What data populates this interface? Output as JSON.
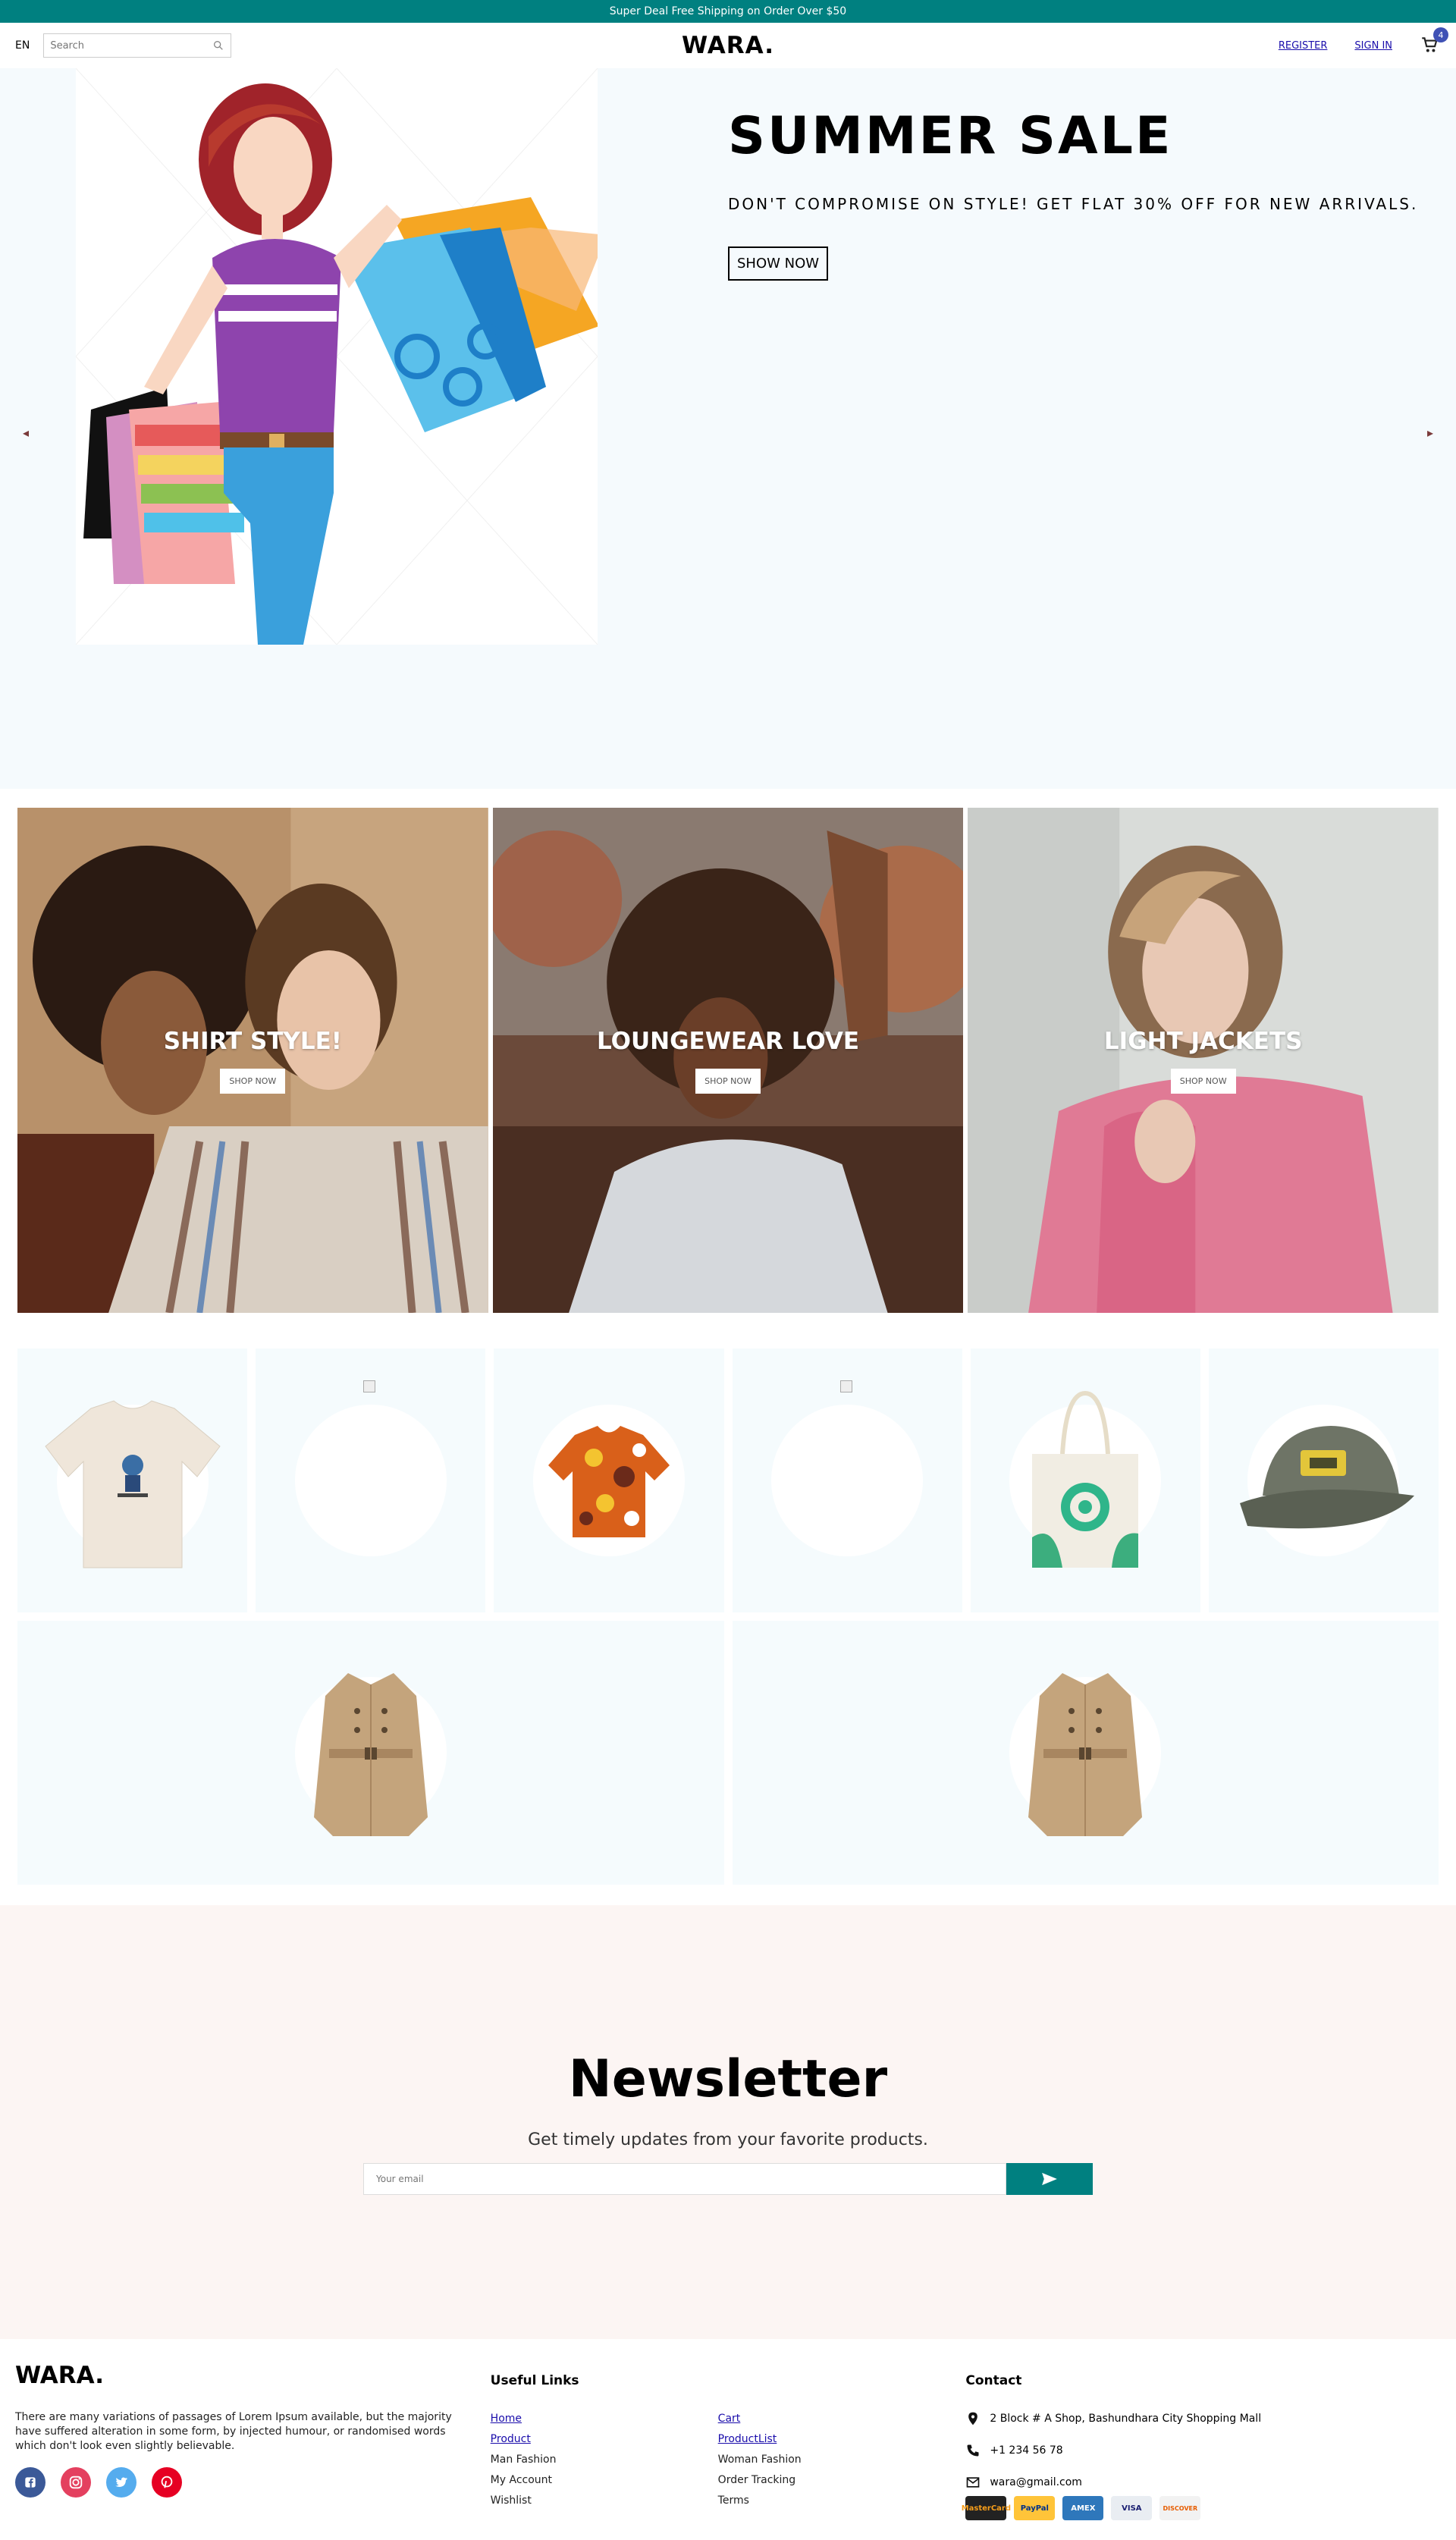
{
  "announcement": {
    "text": "Super Deal Free Shipping on Order Over $50"
  },
  "navbar": {
    "language": "EN",
    "search_placeholder": "Search",
    "logo": "WARA.",
    "register": "REGISTER",
    "signin": "SIGN IN",
    "cart_count": "4"
  },
  "hero": {
    "title": "SUMMER SALE",
    "description": "DON'T COMPROMISE ON STYLE! GET FLAT 30% OFF FOR NEW ARRIVALS.",
    "button": "SHOW NOW",
    "prev_icon": "chevron-left-icon",
    "next_icon": "chevron-right-icon"
  },
  "categories": [
    {
      "title": "SHIRT STYLE!",
      "button": "SHOP NOW"
    },
    {
      "title": "LOUNGEWEAR LOVE",
      "button": "SHOP NOW"
    },
    {
      "title": "LIGHT JACKETS",
      "button": "SHOP NOW"
    }
  ],
  "products": {
    "row1": [
      "t-shirt",
      "broken-image",
      "hawaiian-shirt",
      "broken-image",
      "tote-bag",
      "baseball-cap"
    ],
    "row2": [
      "trench-coat",
      "trench-coat"
    ]
  },
  "newsletter": {
    "title": "Newsletter",
    "description": "Get timely updates from your favorite products.",
    "placeholder": "Your email"
  },
  "footer": {
    "logo": "WARA.",
    "description": "There are many variations of passages of Lorem Ipsum available, but the majority have suffered alteration in some form, by injected humour, or randomised words which don't look even slightly believable.",
    "useful_links_title": "Useful Links",
    "links": [
      "Home",
      "Cart",
      "Product",
      "ProductList",
      "Man Fashion",
      "Woman Fashion",
      "My Account",
      "Order Tracking",
      "Wishlist",
      "Terms"
    ],
    "contact_title": "Contact",
    "address": "2 Block # A Shop, Bashundhara City Shopping Mall",
    "phone": "+1 234 56 78",
    "email": "wara@gmail.com",
    "payments": [
      "MasterCard",
      "PayPal",
      "AMEX",
      "VISA",
      "DISCOVER"
    ]
  },
  "colors": {
    "accent": "#008080",
    "hero_bg": "#f5fafd",
    "newsletter_bg": "#fcf5f3",
    "link": "#1a0dab"
  }
}
